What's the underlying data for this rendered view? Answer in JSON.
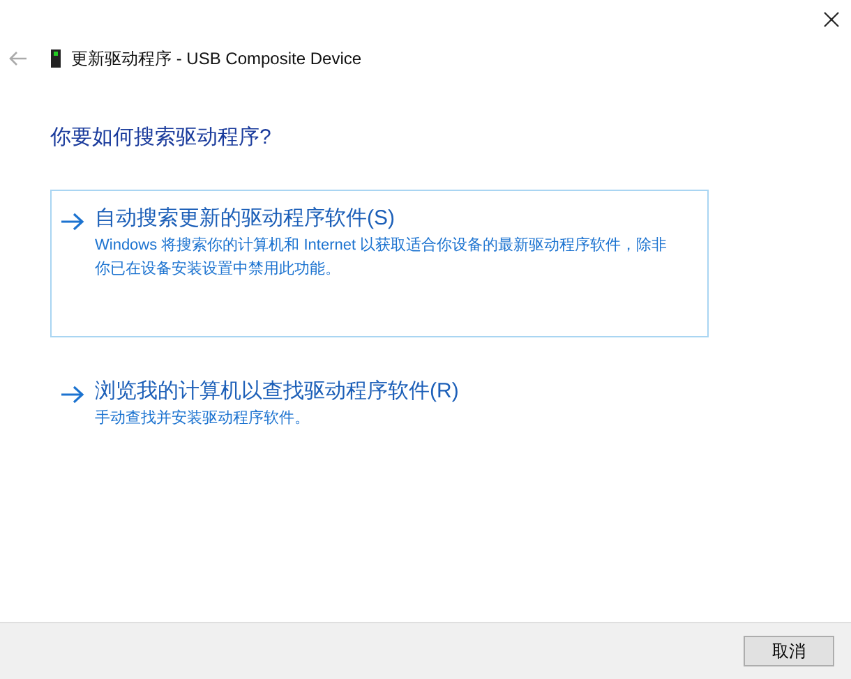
{
  "window": {
    "title": "更新驱动程序 - USB Composite Device"
  },
  "heading": "你要如何搜索驱动程序?",
  "options": [
    {
      "title": "自动搜索更新的驱动程序软件(S)",
      "description": "Windows 将搜索你的计算机和 Internet 以获取适合你设备的最新驱动程序软件，除非你已在设备安装设置中禁用此功能。",
      "highlighted": true
    },
    {
      "title": "浏览我的计算机以查找驱动程序软件(R)",
      "description": "手动查找并安装驱动程序软件。",
      "highlighted": false
    }
  ],
  "buttons": [
    "取消"
  ]
}
